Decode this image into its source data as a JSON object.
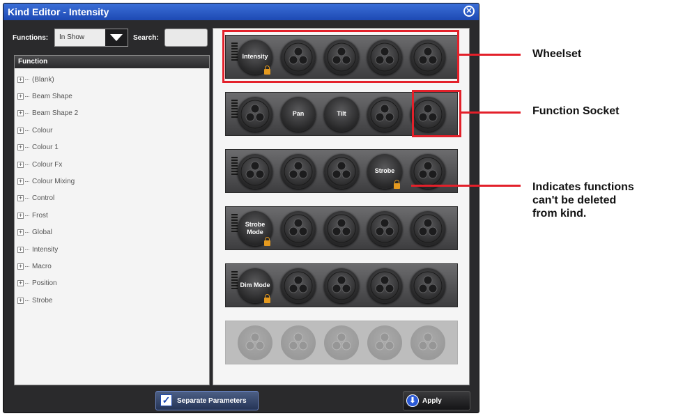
{
  "window": {
    "title": "Kind Editor - Intensity",
    "close_glyph": "⊗"
  },
  "toolbar": {
    "functions_label": "Functions:",
    "functions_value": "In Show",
    "search_label": "Search:",
    "search_value": ""
  },
  "tree": {
    "header": "Function",
    "items": [
      "(Blank)",
      "Beam Shape",
      "Beam Shape 2",
      "Colour",
      "Colour 1",
      "Colour Fx",
      "Colour Mixing",
      "Control",
      "Frost",
      "Global",
      "Intensity",
      "Macro",
      "Position",
      "Strobe"
    ]
  },
  "wheelsets": [
    {
      "sockets": [
        {
          "label": "Intensity",
          "locked": true
        },
        {
          "label": ""
        },
        {
          "label": ""
        },
        {
          "label": ""
        },
        {
          "label": ""
        }
      ]
    },
    {
      "sockets": [
        {
          "label": ""
        },
        {
          "label": "Pan"
        },
        {
          "label": "Tilt"
        },
        {
          "label": ""
        },
        {
          "label": ""
        }
      ]
    },
    {
      "sockets": [
        {
          "label": ""
        },
        {
          "label": ""
        },
        {
          "label": ""
        },
        {
          "label": "Strobe",
          "locked": true
        },
        {
          "label": ""
        }
      ]
    },
    {
      "sockets": [
        {
          "label": "Strobe Mode",
          "locked": true
        },
        {
          "label": ""
        },
        {
          "label": ""
        },
        {
          "label": ""
        },
        {
          "label": ""
        }
      ]
    },
    {
      "sockets": [
        {
          "label": "Dim Mode",
          "locked": true
        },
        {
          "label": ""
        },
        {
          "label": ""
        },
        {
          "label": ""
        },
        {
          "label": ""
        }
      ]
    },
    {
      "disabled": true,
      "sockets": [
        {
          "label": ""
        },
        {
          "label": ""
        },
        {
          "label": ""
        },
        {
          "label": ""
        },
        {
          "label": ""
        }
      ]
    }
  ],
  "buttons": {
    "separate_parameters": "Separate Parameters",
    "separate_checked": true,
    "apply": "Apply"
  },
  "annotations": {
    "wheelset": "Wheelset",
    "function_socket": "Function Socket",
    "locked_note_line1": "Indicates functions",
    "locked_note_line2": "can't be deleted",
    "locked_note_line3": "from kind.",
    "color": "#e3202a"
  },
  "colors": {
    "titlebar": "#1d49b3",
    "window_bg": "#2a2a2c",
    "lock": "#e59a1f"
  }
}
